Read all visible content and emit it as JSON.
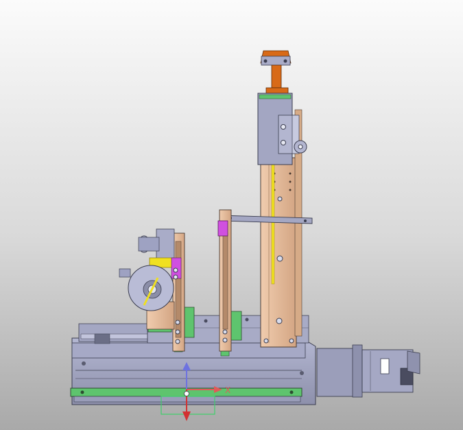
{
  "viewport": {
    "background_top": "#fbfbfb",
    "background_bottom": "#a9a9a9"
  },
  "triad": {
    "x_label": "X",
    "x_color": "#e05a5a",
    "y_color": "#d23232",
    "z_color": "#6d72e0",
    "plane_color": "#3ecf6a"
  },
  "colors": {
    "metal_gray": "#9ea2c2",
    "metal_dark": "#7f839f",
    "copper": "#e2b898",
    "orange": "#d86a18",
    "green_rail": "#5ec46e",
    "yellow": "#f0e020",
    "magenta": "#d050e0"
  }
}
